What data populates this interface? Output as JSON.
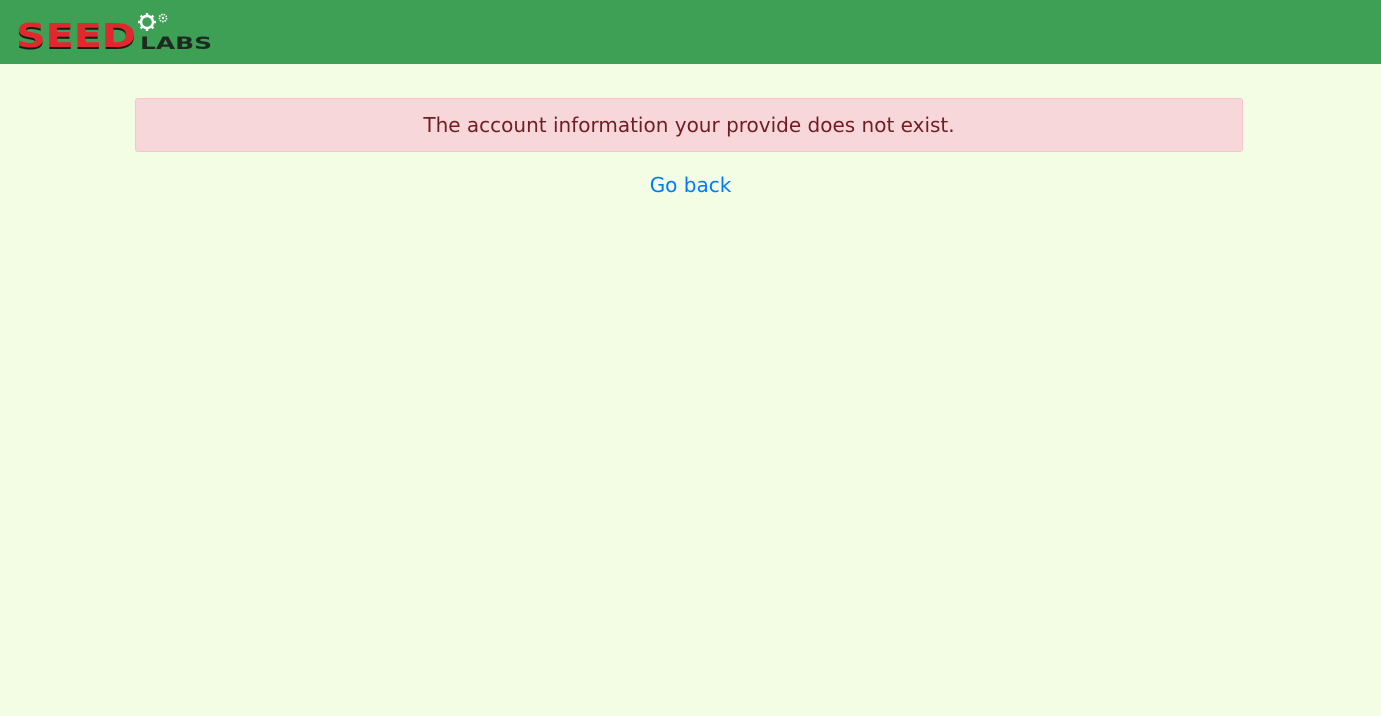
{
  "header": {
    "logo": {
      "text_seed": "SEED",
      "text_labs": "LABS",
      "colors": {
        "seed": "#e0282d",
        "labs": "#1c2a22",
        "gear": "#ffffff"
      }
    }
  },
  "alert": {
    "message": "The account information your provide does not exist."
  },
  "link": {
    "go_back_label": "Go back"
  },
  "colors": {
    "header_bg": "#3ea055",
    "page_bg": "#f2fde4",
    "alert_bg": "#f8d7da",
    "alert_text": "#721c24",
    "link": "#007bff"
  }
}
